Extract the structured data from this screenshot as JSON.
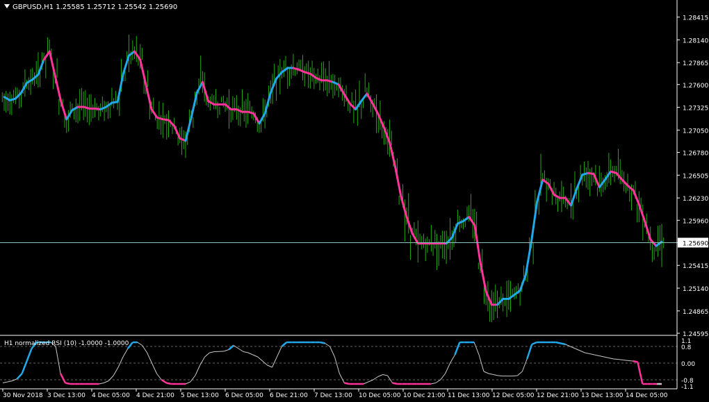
{
  "header": {
    "symbol_title": "GBPUSD,H1  1.25585 1.25712 1.25542 1.25690"
  },
  "indicator": {
    "title": "H1 normalized RSI (10) -1.0000 -1.0000"
  },
  "colors": {
    "background": "#000000",
    "axis": "#ffffff",
    "bars": "#22aa11",
    "line_up": "#22a8e8",
    "line_down": "#ff3399",
    "rsi_line": "#c8c8c8",
    "price_line": "#8fbfbf",
    "level_line": "#666666"
  },
  "chart_data": [
    {
      "type": "line",
      "title": "GBPUSD,H1",
      "ylim": [
        1.24595,
        1.2842
      ],
      "y_ticks": [
        "1.28415",
        "1.28140",
        "1.27865",
        "1.27600",
        "1.27325",
        "1.27050",
        "1.26780",
        "1.26505",
        "1.26230",
        "1.25960",
        "1.25690",
        "1.25415",
        "1.25140",
        "1.24865",
        "1.24595"
      ],
      "current_price": "1.25690",
      "x_labels": [
        "30 Nov 2018",
        "3 Dec 13:00",
        "4 Dec 05:00",
        "4 Dec 21:00",
        "5 Dec 13:00",
        "6 Dec 05:00",
        "6 Dec 21:00",
        "7 Dec 13:00",
        "10 Dec 05:00",
        "10 Dec 21:00",
        "11 Dec 13:00",
        "12 Dec 05:00",
        "12 Dec 21:00",
        "13 Dec 13:00",
        "14 Dec 05:00"
      ],
      "series": [
        {
          "values": [
            1.2745,
            1.2741,
            1.2743,
            1.275,
            1.2762,
            1.2766,
            1.2772,
            1.279,
            1.28,
            1.277,
            1.274,
            1.2718,
            1.2729,
            1.2733,
            1.2733,
            1.2731,
            1.2731,
            1.273,
            1.2733,
            1.2738,
            1.2739,
            1.2773,
            1.2795,
            1.28,
            1.279,
            1.276,
            1.273,
            1.272,
            1.2718,
            1.2717,
            1.271,
            1.2695,
            1.2692,
            1.272,
            1.275,
            1.2763,
            1.274,
            1.2736,
            1.2736,
            1.2736,
            1.273,
            1.273,
            1.2727,
            1.2727,
            1.2725,
            1.2713,
            1.2725,
            1.275,
            1.2767,
            1.2775,
            1.278,
            1.278,
            1.2778,
            1.2775,
            1.2773,
            1.2768,
            1.2765,
            1.2765,
            1.2763,
            1.276,
            1.2748,
            1.2737,
            1.273,
            1.274,
            1.2749,
            1.2737,
            1.2724,
            1.2708,
            1.269,
            1.266,
            1.2625,
            1.26,
            1.258,
            1.2568,
            1.2568,
            1.2568,
            1.2568,
            1.2568,
            1.2568,
            1.2575,
            1.2592,
            1.2595,
            1.26,
            1.259,
            1.2545,
            1.251,
            1.2494,
            1.2494,
            1.2501,
            1.2501,
            1.2506,
            1.2511,
            1.253,
            1.257,
            1.2618,
            1.2645,
            1.264,
            1.2627,
            1.2623,
            1.2623,
            1.2614,
            1.2634,
            1.2651,
            1.2653,
            1.2652,
            1.2636,
            1.2645,
            1.2655,
            1.2653,
            1.2645,
            1.2638,
            1.2632,
            1.2615,
            1.2595,
            1.2573,
            1.2565,
            1.257
          ],
          "direction": [
            "u",
            "u",
            "u",
            "u",
            "u",
            "u",
            "u",
            "u",
            "d",
            "d",
            "d",
            "d",
            "u",
            "u",
            "d",
            "d",
            "d",
            "d",
            "u",
            "u",
            "u",
            "u",
            "u",
            "u",
            "d",
            "d",
            "d",
            "d",
            "d",
            "d",
            "d",
            "d",
            "d",
            "u",
            "u",
            "u",
            "d",
            "d",
            "d",
            "d",
            "d",
            "d",
            "d",
            "d",
            "d",
            "d",
            "u",
            "u",
            "u",
            "u",
            "u",
            "u",
            "d",
            "d",
            "d",
            "d",
            "d",
            "d",
            "d",
            "u",
            "d",
            "d",
            "d",
            "u",
            "u",
            "d",
            "d",
            "d",
            "d",
            "d",
            "d",
            "d",
            "d",
            "d",
            "d",
            "d",
            "d",
            "d",
            "d",
            "u",
            "u",
            "u",
            "u",
            "d",
            "d",
            "d",
            "d",
            "d",
            "u",
            "u",
            "u",
            "u",
            "u",
            "u",
            "u",
            "u",
            "d",
            "d",
            "d",
            "d",
            "d",
            "u",
            "u",
            "u",
            "d",
            "d",
            "u",
            "u",
            "d",
            "d",
            "d",
            "d",
            "d",
            "d",
            "d",
            "d",
            "u"
          ]
        }
      ]
    },
    {
      "type": "line",
      "title": "H1 normalized RSI (10)",
      "ylim": [
        -1.1,
        1.1
      ],
      "y_ticks": [
        "1.1",
        "0.8",
        "0.00",
        "-0.8",
        "-1.1"
      ],
      "levels": [
        0.8,
        0.0,
        -0.8
      ],
      "series": [
        {
          "values": [
            -0.95,
            -0.9,
            -0.85,
            -0.75,
            -0.5,
            0.1,
            0.7,
            1.0,
            1.0,
            1.0,
            1.0,
            0.8,
            -0.5,
            -0.95,
            -1.0,
            -1.0,
            -1.0,
            -1.0,
            -1.0,
            -1.0,
            -1.0,
            -0.95,
            -0.85,
            -0.6,
            -0.2,
            0.3,
            0.7,
            1.0,
            1.0,
            0.85,
            0.5,
            0.0,
            -0.5,
            -0.8,
            -0.95,
            -1.0,
            -1.0,
            -1.0,
            -1.0,
            -0.9,
            -0.6,
            -0.1,
            0.3,
            0.5,
            0.55,
            0.56,
            0.57,
            0.65,
            0.85,
            0.7,
            0.55,
            0.5,
            0.4,
            0.3,
            0.1,
            -0.1,
            -0.2,
            0.3,
            0.8,
            1.0,
            1.0,
            1.0,
            1.0,
            1.0,
            1.0,
            1.0,
            1.0,
            0.95,
            0.8,
            0.3,
            -0.5,
            -0.95,
            -1.0,
            -1.0,
            -1.0,
            -1.0,
            -0.9,
            -0.8,
            -0.65,
            -0.55,
            -0.6,
            -0.95,
            -1.0,
            -1.0,
            -1.0,
            -1.0,
            -1.0,
            -1.0,
            -1.0,
            -1.0,
            -0.95,
            -0.8,
            -0.5,
            0.0,
            0.4,
            1.0,
            1.0,
            1.0,
            1.0,
            0.4,
            -0.4,
            -0.5,
            -0.55,
            -0.6,
            -0.62,
            -0.62,
            -0.62,
            -0.6,
            -0.4,
            0.2,
            0.9,
            1.0,
            1.0,
            1.0,
            1.0,
            1.0,
            0.95,
            0.9,
            0.8,
            0.7,
            0.6,
            0.5,
            0.45,
            0.4,
            0.35,
            0.3,
            0.25,
            0.2,
            0.18,
            0.15,
            0.12,
            0.1,
            0.05,
            -1.0,
            -1.0,
            -1.0,
            -1.0,
            -1.0
          ],
          "direction": [
            "n",
            "n",
            "n",
            "n",
            "u",
            "u",
            "u",
            "u",
            "u",
            "u",
            "u",
            "n",
            "n",
            "d",
            "d",
            "d",
            "d",
            "d",
            "d",
            "d",
            "d",
            "n",
            "n",
            "n",
            "n",
            "n",
            "n",
            "u",
            "u",
            "n",
            "n",
            "n",
            "n",
            "n",
            "d",
            "d",
            "d",
            "d",
            "d",
            "n",
            "n",
            "n",
            "n",
            "n",
            "n",
            "n",
            "n",
            "n",
            "u",
            "n",
            "n",
            "n",
            "n",
            "n",
            "n",
            "n",
            "n",
            "n",
            "n",
            "u",
            "u",
            "u",
            "u",
            "u",
            "u",
            "u",
            "u",
            "u",
            "n",
            "n",
            "n",
            "n",
            "d",
            "d",
            "d",
            "d",
            "n",
            "n",
            "n",
            "n",
            "n",
            "n",
            "d",
            "d",
            "d",
            "d",
            "d",
            "d",
            "d",
            "d",
            "n",
            "n",
            "n",
            "n",
            "n",
            "u",
            "u",
            "u",
            "u",
            "n",
            "n",
            "n",
            "n",
            "n",
            "n",
            "n",
            "n",
            "n",
            "n",
            "n",
            "u",
            "u",
            "u",
            "u",
            "u",
            "u",
            "u",
            "u",
            "n",
            "n",
            "n",
            "n",
            "n",
            "n",
            "n",
            "n",
            "n",
            "n",
            "n",
            "n",
            "n",
            "n",
            "d",
            "d",
            "d",
            "d",
            "d"
          ]
        }
      ]
    }
  ]
}
